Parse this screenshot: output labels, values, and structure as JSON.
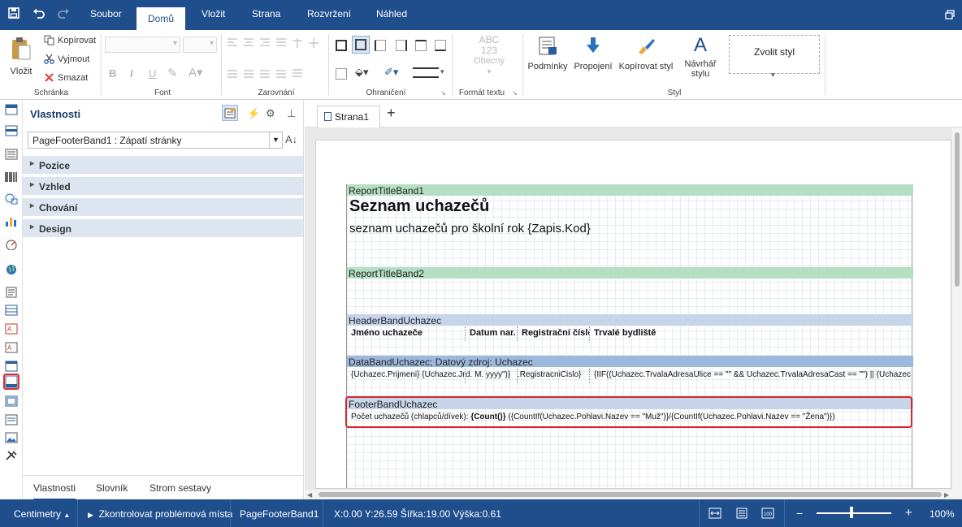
{
  "menu": {
    "tabs": [
      "Soubor",
      "Domů",
      "Vložit",
      "Strana",
      "Rozvržení",
      "Náhled"
    ],
    "active_tab": "Domů"
  },
  "ribbon": {
    "clipboard": {
      "paste": "Vložit",
      "copy": "Kopírovat",
      "cut": "Vyjmout",
      "delete": "Smazat",
      "group": "Schránka"
    },
    "font": {
      "group": "Font",
      "bold": "B",
      "italic": "I",
      "underline": "U"
    },
    "alignment": {
      "group": "Zarovnání"
    },
    "borders": {
      "group": "Ohraničení"
    },
    "text_format": {
      "group": "Formát textu",
      "sample_top": "ABC",
      "sample_mid": "123",
      "sample_label": "Obecný"
    },
    "style": {
      "group": "Styl",
      "conditions": "Podmínky",
      "links": "Propojení",
      "copy_style": "Kopírovat styl",
      "style_designer_line1": "Návrhář",
      "style_designer_line2": "stylu",
      "choose_style": "Zvolit styl"
    }
  },
  "properties": {
    "title": "Vlastnosti",
    "selected_object": "PageFooterBand1 : Zápatí stránky",
    "categories": [
      "Pozice",
      "Vzhled",
      "Chování",
      "Design"
    ],
    "bottom_tabs": [
      "Vlastnosti",
      "Slovník",
      "Strom sestavy"
    ],
    "active_bottom_tab": "Vlastnosti"
  },
  "document": {
    "tab": "Strana1",
    "bands": {
      "report_title_1": {
        "name": "ReportTitleBand1",
        "title": "Seznam uchazečů",
        "subtitle": "seznam uchazečů pro školní rok {Zapis.Kod}"
      },
      "report_title_2": {
        "name": "ReportTitleBand2"
      },
      "header": {
        "name": "HeaderBandUchazec",
        "columns": [
          "Jméno uchazeče",
          "Datum nar.",
          "Registrační číslo",
          "Trvalé bydliště"
        ]
      },
      "data": {
        "name": "DataBandUchazec; Datový zdroj: Uchazec",
        "cells": [
          "{Uchazec.Prijmeni} {Uchazec.Jmeno}",
          "d. M. yyyy\")}",
          ".RegistracniCislo}",
          "{IIF((Uchazec.TrvalaAdresaUlice == \"\" && Uchazec.TrvalaAdresaCast == \"\") || (Uchazec"
        ]
      },
      "footer": {
        "name": "FooterBandUchazec",
        "text_prefix": "Počet uchazečů (chlapců/dívek): ",
        "text_bold": "{Count()}",
        "text_suffix": " ({CountIf(Uchazec.Pohlavi.Nazev == \"Muž\")}/{CountIf(Uchazec.Pohlavi.Nazev == \"Žena\")})"
      }
    }
  },
  "status_bar": {
    "units": "Centimetry",
    "check": "Zkontrolovat problémová místa",
    "selected": "PageFooterBand1",
    "coords": "X:0.00 Y:26.59 Šířka:19.00 Výška:0.61",
    "zoom": "100%",
    "zoom_minus": "−",
    "zoom_plus": "+"
  },
  "colors": {
    "brand": "#1f4e8c",
    "band_green": "#b5dfc2",
    "band_blue": "#c6d5ea",
    "band_blue_dark": "#9db8dc",
    "selection": "#d9242b"
  }
}
